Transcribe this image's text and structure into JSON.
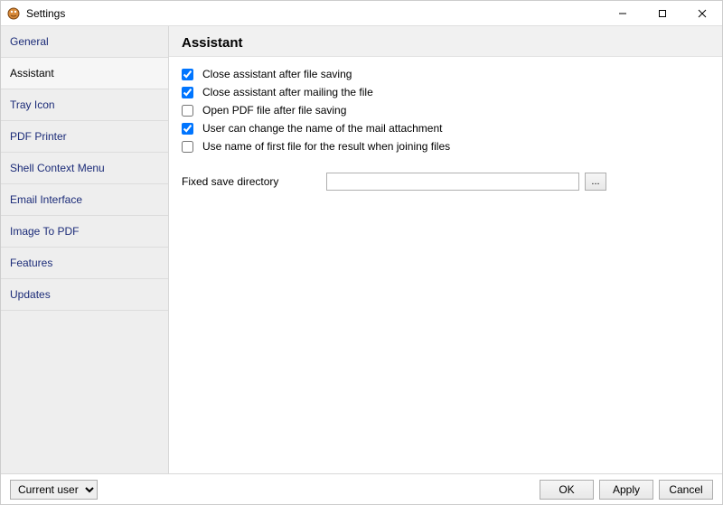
{
  "window": {
    "title": "Settings"
  },
  "sidebar": {
    "items": [
      {
        "label": "General"
      },
      {
        "label": "Assistant"
      },
      {
        "label": "Tray Icon"
      },
      {
        "label": "PDF Printer"
      },
      {
        "label": "Shell Context Menu"
      },
      {
        "label": "Email Interface"
      },
      {
        "label": "Image To PDF"
      },
      {
        "label": "Features"
      },
      {
        "label": "Updates"
      }
    ],
    "active_index": 1
  },
  "panel": {
    "title": "Assistant",
    "options": [
      {
        "label": "Close assistant after file saving",
        "checked": true
      },
      {
        "label": "Close assistant after mailing the file",
        "checked": true
      },
      {
        "label": "Open PDF file after file saving",
        "checked": false
      },
      {
        "label": "User can change the name of the mail attachment",
        "checked": true
      },
      {
        "label": "Use name of first file for the result when joining files",
        "checked": false
      }
    ],
    "fixed_dir_label": "Fixed save directory",
    "fixed_dir_value": "",
    "fixed_dir_placeholder": "",
    "browse_label": "..."
  },
  "bottom": {
    "scope_selected": "Current user",
    "ok": "OK",
    "apply": "Apply",
    "cancel": "Cancel"
  }
}
